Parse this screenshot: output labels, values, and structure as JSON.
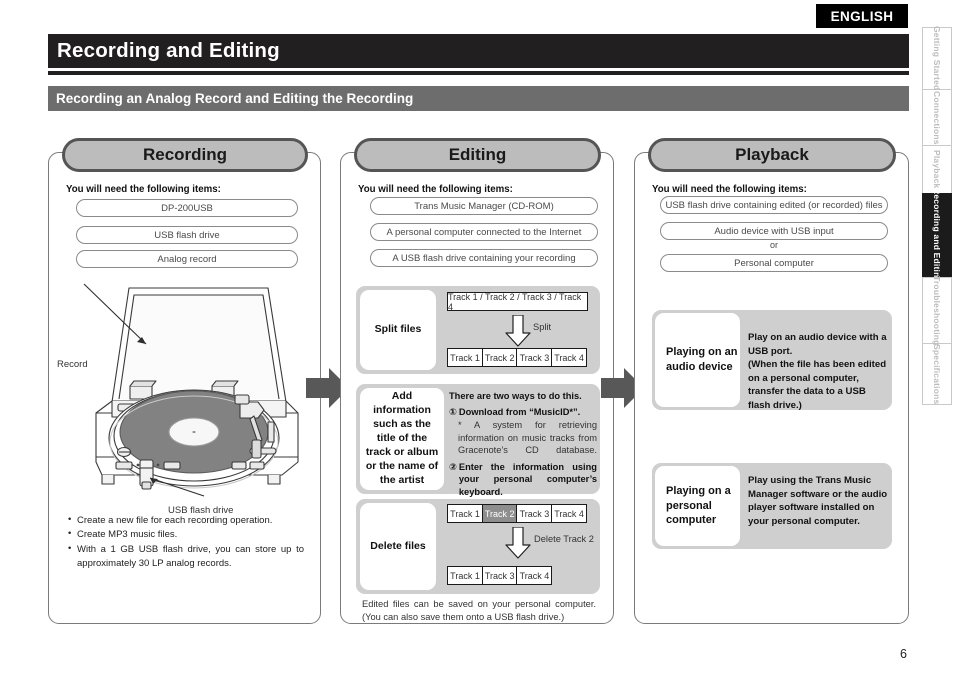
{
  "badge": {
    "language": "ENGLISH"
  },
  "header": {
    "title": "Recording and Editing",
    "subtitle": "Recording an Analog Record and Editing the Recording"
  },
  "side_tabs": [
    {
      "label": "Getting Started",
      "active": false
    },
    {
      "label": "Connections",
      "active": false
    },
    {
      "label": "Playback",
      "active": false
    },
    {
      "label": "Recording and Editing",
      "active": true
    },
    {
      "label": "Troubleshooting",
      "active": false
    },
    {
      "label": "Specifications",
      "active": false
    }
  ],
  "flow": {
    "arrow_color": "#585858",
    "recording": {
      "heading": "Recording",
      "need_label": "You will need the following items:",
      "items": [
        "DP-200USB",
        "USB flash drive",
        "Analog record"
      ],
      "callout_record": "Record",
      "callout_usb": "USB flash drive",
      "bullets": [
        "Create a new file for each recording operation.",
        "Create MP3 music files.",
        "With a 1 GB USB flash drive, you can store up to approximately 30 LP analog records."
      ]
    },
    "editing": {
      "heading": "Editing",
      "need_label": "You will need the following items:",
      "items": [
        "Trans Music Manager (CD-ROM)",
        "A personal computer connected to the Internet",
        "A USB flash drive containing your recording"
      ],
      "split": {
        "title": "Split files",
        "before": "Track 1 / Track 2 / Track 3 / Track 4",
        "operation": "Split",
        "after": [
          "Track 1",
          "Track 2",
          "Track 3",
          "Track 4"
        ]
      },
      "add_info": {
        "title": "Add information such as the title of the track or album or the name of the artist",
        "intro": "There are two ways to do this.",
        "step1_marker": "①",
        "step1": "Download from “MusicID*”.",
        "footnote_marker": "*",
        "footnote": "A system for retrieving information on music tracks from Gracenote’s CD database.",
        "step2_marker": "②",
        "step2": "Enter the information using your personal computer’s keyboard."
      },
      "delete": {
        "title": "Delete files",
        "before": [
          "Track 1",
          "Track 2",
          "Track 3",
          "Track 4"
        ],
        "selected_index": 1,
        "operation": "Delete Track 2",
        "after": [
          "Track 1",
          "Track 3",
          "Track 4"
        ]
      },
      "note": "Edited files can be saved on your personal computer. (You can also save them onto a USB flash drive.)"
    },
    "playback": {
      "heading": "Playback",
      "need_label": "You will need the following items:",
      "items": [
        "USB flash drive containing edited (or recorded) files",
        "Audio device with USB input",
        "Personal computer"
      ],
      "or_text": "or",
      "cards": [
        {
          "title": "Playing on an audio device",
          "body": "Play on an audio device with a USB port.\n(When the file has been edited on a personal computer, transfer the data to a USB flash drive.)"
        },
        {
          "title": "Playing on a personal computer",
          "body": "Play using the Trans Music Manager software or the audio player software installed on your personal computer."
        }
      ]
    }
  },
  "footer": {
    "page_number": "6"
  }
}
